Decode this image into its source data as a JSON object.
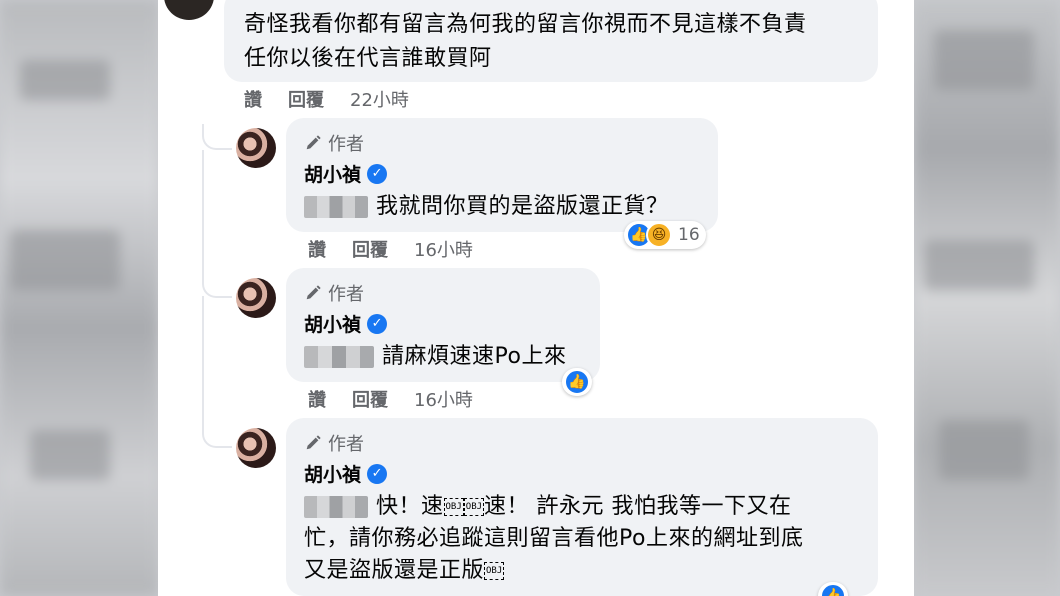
{
  "top_comment": {
    "text_line1": "奇怪我看你都有留言為何我的留言你視而不見這樣不負責",
    "text_line2": "任你以後在代言誰敢買阿",
    "like_label": "讚",
    "reply_label": "回覆",
    "time": "22小時"
  },
  "replies": [
    {
      "author_badge": "作者",
      "name": "胡小禎",
      "text": "我就問你買的是盜版還正貨？",
      "like_label": "讚",
      "reply_label": "回覆",
      "time": "16小時",
      "reaction_count": "16"
    },
    {
      "author_badge": "作者",
      "name": "胡小禎",
      "text": "請麻煩速速Po上來",
      "like_label": "讚",
      "reply_label": "回覆",
      "time": "16小時"
    },
    {
      "author_badge": "作者",
      "name": "胡小禎",
      "text_part1": "快！速",
      "text_part2": "速！ 許永元 我怕我等一下又在",
      "text_line2": "忙，請你務必追蹤這則留言看他Po上來的網址到底",
      "text_line3": "又是盜版還是正版",
      "obj_glyph": "OBJ"
    }
  ],
  "colors": {
    "verified": "#1877f2",
    "bubble": "#f0f2f5",
    "meta_text": "#65676b"
  }
}
